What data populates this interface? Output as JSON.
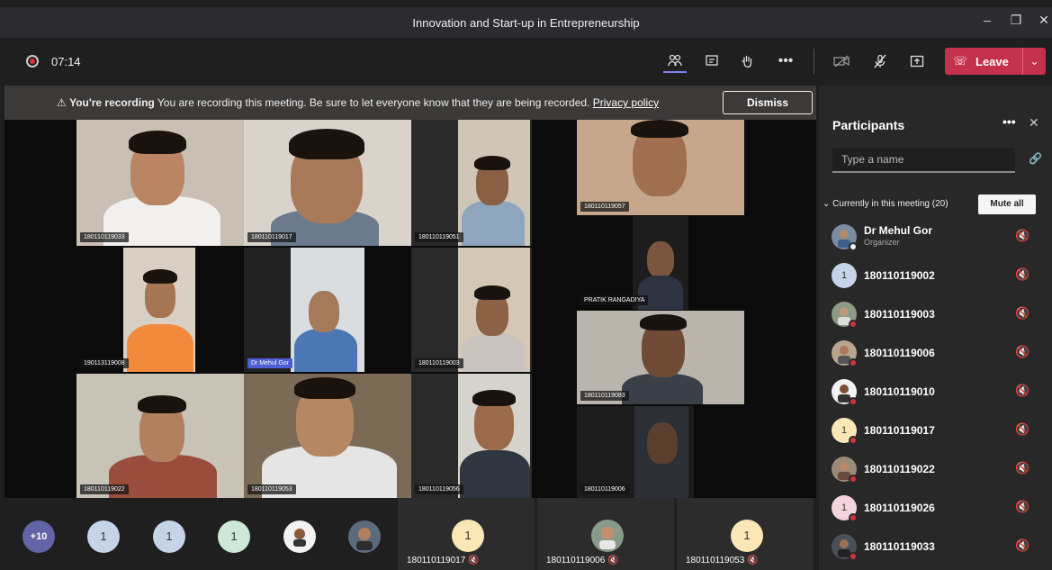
{
  "window": {
    "title": "Innovation and Start-up in Entrepreneurship"
  },
  "toolbar": {
    "timer": "07:14",
    "leave_label": "Leave"
  },
  "banner": {
    "heading": "You're recording",
    "message": "You are recording this meeting. Be sure to let everyone know that they are being recorded.",
    "link": "Privacy policy",
    "dismiss": "Dismiss"
  },
  "tiles": [
    "180110119033",
    "180110119017",
    "180110119051",
    "180110119057",
    "PRATIK RANGADIYA",
    "190113119008",
    "Dr Mehul Gor",
    "180110119003",
    "180110119083",
    "180110119022",
    "180110119053",
    "180110119056",
    "180110119006"
  ],
  "strip": {
    "overflow": "+10",
    "avatars": [
      "1",
      "1",
      "1"
    ],
    "cards": [
      {
        "name": "180110119017",
        "initial": "1"
      },
      {
        "name": "180110119006",
        "initial": ""
      },
      {
        "name": "180110119053",
        "initial": "1"
      }
    ]
  },
  "panel": {
    "title": "Participants",
    "search_placeholder": "Type a name",
    "section": "Currently in this meeting (20)",
    "mute_all": "Mute all",
    "participants": [
      {
        "name": "Dr Mehul Gor",
        "role": "Organizer",
        "initial": ""
      },
      {
        "name": "180110119002",
        "initial": "1"
      },
      {
        "name": "180110119003",
        "initial": ""
      },
      {
        "name": "180110119006",
        "initial": ""
      },
      {
        "name": "180110119010",
        "initial": ""
      },
      {
        "name": "180110119017",
        "initial": "1"
      },
      {
        "name": "180110119022",
        "initial": ""
      },
      {
        "name": "180110119026",
        "initial": "1"
      },
      {
        "name": "180110119033",
        "initial": ""
      }
    ]
  },
  "colors": {
    "leave": "#c4314b",
    "accent": "#7f85f5",
    "presence_busy": "#d13438"
  }
}
